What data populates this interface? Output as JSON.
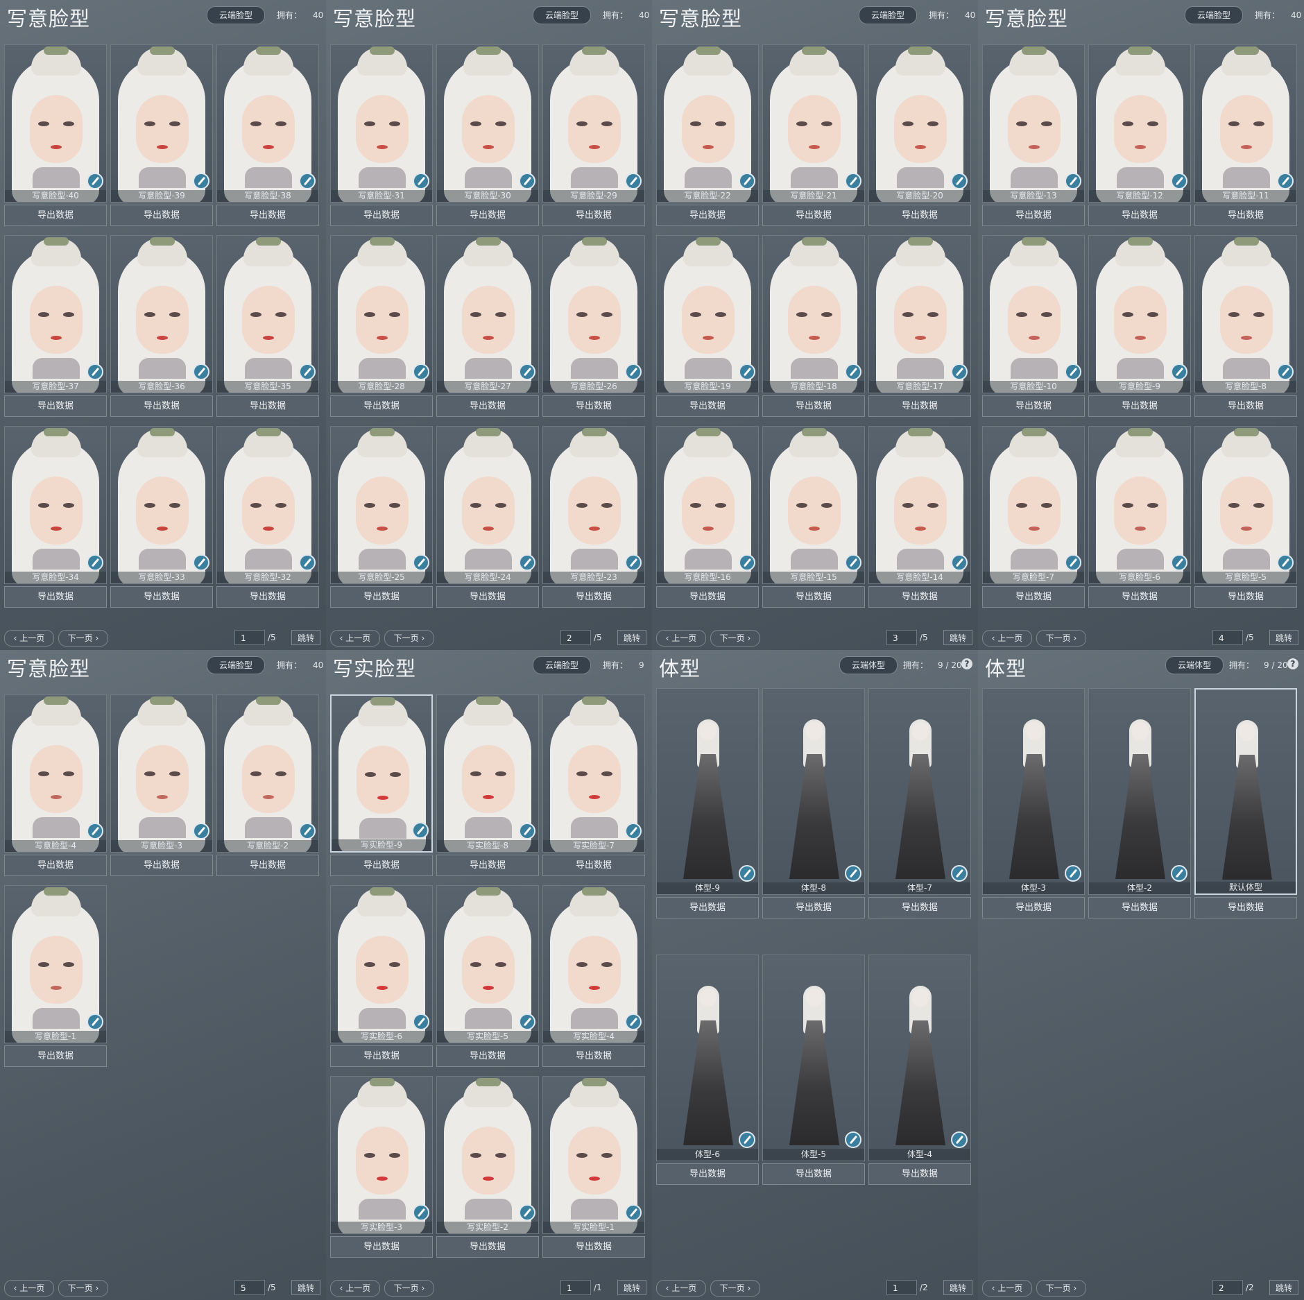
{
  "labels": {
    "cloud_face": "云端脸型",
    "cloud_body": "云端体型",
    "owned": "拥有：",
    "export": "导出数据",
    "prev": "上一页",
    "next": "下一页",
    "jump": "跳转",
    "help": "?"
  },
  "colors": {
    "brush_badge": "#3b7f9f",
    "panel_bg": "#58636c",
    "card_border": "#6e7982"
  },
  "icons": {
    "edit": "brush-icon",
    "prev": "chevron-left-icon",
    "next": "chevron-right-icon",
    "help": "question-icon"
  },
  "panels": [
    {
      "title": "写意脸型",
      "cloud": "云端脸型",
      "owned_label": "拥有：",
      "owned": "40",
      "kind": "face",
      "lips": "#c9433f",
      "cards": [
        {
          "name": "写意脸型-40",
          "edit": true
        },
        {
          "name": "写意脸型-39",
          "edit": true
        },
        {
          "name": "写意脸型-38",
          "edit": true
        },
        {
          "name": "写意脸型-37",
          "edit": true
        },
        {
          "name": "写意脸型-36",
          "edit": true
        },
        {
          "name": "写意脸型-35",
          "edit": true
        },
        {
          "name": "写意脸型-34",
          "edit": true
        },
        {
          "name": "写意脸型-33",
          "edit": true
        },
        {
          "name": "写意脸型-32",
          "edit": true
        }
      ],
      "page": "1",
      "total": "/5"
    },
    {
      "title": "写意脸型",
      "cloud": "云端脸型",
      "owned_label": "拥有：",
      "owned": "40",
      "kind": "face",
      "lips": "#c84f45",
      "cards": [
        {
          "name": "写意脸型-31",
          "edit": true
        },
        {
          "name": "写意脸型-30",
          "edit": true
        },
        {
          "name": "写意脸型-29",
          "edit": true
        },
        {
          "name": "写意脸型-28",
          "edit": true
        },
        {
          "name": "写意脸型-27",
          "edit": true
        },
        {
          "name": "写意脸型-26",
          "edit": true
        },
        {
          "name": "写意脸型-25",
          "edit": true
        },
        {
          "name": "写意脸型-24",
          "edit": true
        },
        {
          "name": "写意脸型-23",
          "edit": true
        }
      ],
      "page": "2",
      "total": "/5"
    },
    {
      "title": "写意脸型",
      "cloud": "云端脸型",
      "owned_label": "拥有：",
      "owned": "40",
      "kind": "face",
      "lips": "#c55a4f",
      "cards": [
        {
          "name": "写意脸型-22",
          "edit": true
        },
        {
          "name": "写意脸型-21",
          "edit": true
        },
        {
          "name": "写意脸型-20",
          "edit": true
        },
        {
          "name": "写意脸型-19",
          "edit": true
        },
        {
          "name": "写意脸型-18",
          "edit": true
        },
        {
          "name": "写意脸型-17",
          "edit": true
        },
        {
          "name": "写意脸型-16",
          "edit": true
        },
        {
          "name": "写意脸型-15",
          "edit": true
        },
        {
          "name": "写意脸型-14",
          "edit": true
        }
      ],
      "page": "3",
      "total": "/5"
    },
    {
      "title": "写意脸型",
      "cloud": "云端脸型",
      "owned_label": "拥有：",
      "owned": "40",
      "kind": "face",
      "lips": "#c4625a",
      "cards": [
        {
          "name": "写意脸型-13",
          "edit": true
        },
        {
          "name": "写意脸型-12",
          "edit": true
        },
        {
          "name": "写意脸型-11",
          "edit": true
        },
        {
          "name": "写意脸型-10",
          "edit": true
        },
        {
          "name": "写意脸型-9",
          "edit": true
        },
        {
          "name": "写意脸型-8",
          "edit": true
        },
        {
          "name": "写意脸型-7",
          "edit": true
        },
        {
          "name": "写意脸型-6",
          "edit": true
        },
        {
          "name": "写意脸型-5",
          "edit": true
        }
      ],
      "page": "4",
      "total": "/5"
    },
    {
      "title": "写意脸型",
      "cloud": "云端脸型",
      "owned_label": "拥有：",
      "owned": "40",
      "kind": "face",
      "lips": "#c2675d",
      "cards": [
        {
          "name": "写意脸型-4",
          "edit": true
        },
        {
          "name": "写意脸型-3",
          "edit": true
        },
        {
          "name": "写意脸型-2",
          "edit": true
        },
        {
          "name": "写意脸型-1",
          "edit": true
        }
      ],
      "page": "5",
      "total": "/5"
    },
    {
      "title": "写实脸型",
      "cloud": "云端脸型",
      "owned_label": "拥有：",
      "owned": "9",
      "kind": "face",
      "lips": "#d23a3a",
      "cards": [
        {
          "name": "写实脸型-9",
          "edit": true,
          "selected": true
        },
        {
          "name": "写实脸型-8",
          "edit": true
        },
        {
          "name": "写实脸型-7",
          "edit": true
        },
        {
          "name": "写实脸型-6",
          "edit": true
        },
        {
          "name": "写实脸型-5",
          "edit": true
        },
        {
          "name": "写实脸型-4",
          "edit": true
        },
        {
          "name": "写实脸型-3",
          "edit": true
        },
        {
          "name": "写实脸型-2",
          "edit": true
        },
        {
          "name": "写实脸型-1",
          "edit": true
        }
      ],
      "page": "1",
      "total": "/1"
    },
    {
      "title": "体型",
      "cloud": "云端体型",
      "owned_label": "拥有：",
      "owned": "9 / 20",
      "help": true,
      "kind": "body",
      "cards": [
        {
          "name": "体型-9",
          "edit": true
        },
        {
          "name": "体型-8",
          "edit": true
        },
        {
          "name": "体型-7",
          "edit": true
        },
        {
          "name": "体型-6",
          "edit": true
        },
        {
          "name": "体型-5",
          "edit": true
        },
        {
          "name": "体型-4",
          "edit": true
        }
      ],
      "page": "1",
      "total": "/2"
    },
    {
      "title": "体型",
      "cloud": "云端体型",
      "owned_label": "拥有：",
      "owned": "9 / 20",
      "help": true,
      "kind": "body",
      "cards": [
        {
          "name": "体型-3",
          "edit": true
        },
        {
          "name": "体型-2",
          "edit": true
        },
        {
          "name": "默认体型",
          "edit": false,
          "selected": true
        }
      ],
      "page": "2",
      "total": "/2"
    }
  ]
}
